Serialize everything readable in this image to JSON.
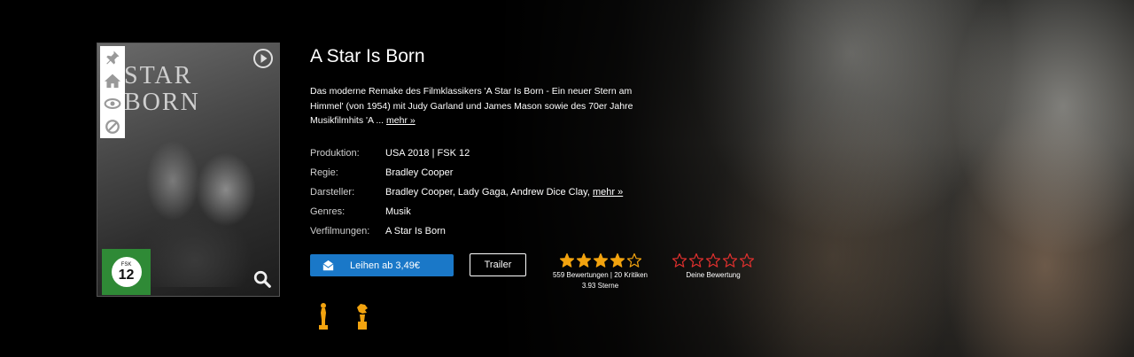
{
  "movie": {
    "title": "A Star Is Born",
    "description": "Das moderne Remake des Filmklassikers 'A Star Is Born - Ein neuer Stern am Himmel' (von 1954) mit Judy Garland und James Mason sowie des 70er Jahre Musikfilmhits 'A ...",
    "more_link": "mehr »"
  },
  "poster": {
    "title_lines": [
      "STAR",
      "BORN"
    ],
    "fsk_label": "FSK",
    "fsk_age": "12",
    "side_icons": [
      "pin-icon",
      "home-icon",
      "eye-icon",
      "block-icon"
    ],
    "play_icon": "play-circle-icon",
    "zoom_icon": "magnifier-icon"
  },
  "details": [
    {
      "label": "Produktion:",
      "value": "USA 2018 | FSK 12"
    },
    {
      "label": "Regie:",
      "value": "Bradley Cooper"
    },
    {
      "label": "Darsteller:",
      "value": "Bradley Cooper, Lady Gaga, Andrew Dice Clay, ",
      "link": "mehr »"
    },
    {
      "label": "Genres:",
      "value": "Musik"
    },
    {
      "label": "Verfilmungen:",
      "value": "A Star Is Born"
    }
  ],
  "actions": {
    "rent_label": "Leihen ab 3,49€",
    "trailer_label": "Trailer"
  },
  "rating": {
    "average": 3.93,
    "max": 5,
    "count_text": "559 Bewertungen | 20 Kritiken",
    "average_text": "3.93 Sterne",
    "user_label": "Deine Bewertung",
    "user_value": 0
  },
  "colors": {
    "accent_blue": "#1a78c8",
    "star_gold": "#f2a30f",
    "star_red": "#e0302e",
    "fsk_green": "#2f8a36",
    "award_gold": "#f2a30f"
  },
  "awards": [
    "oscar-icon",
    "award-trophy-icon"
  ]
}
